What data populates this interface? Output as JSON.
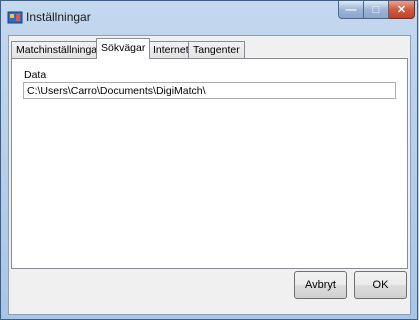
{
  "window": {
    "title": "Inställningar"
  },
  "title_controls": {
    "minimize": "—",
    "maximize": "□",
    "close": "✕"
  },
  "tabs": [
    {
      "label": "Matchinställningar",
      "active": false
    },
    {
      "label": "Sökvägar",
      "active": true
    },
    {
      "label": "Internet",
      "active": false
    },
    {
      "label": "Tangenter",
      "active": false
    }
  ],
  "panel": {
    "data_label": "Data",
    "data_path": "C:\\Users\\Carro\\Documents\\DigiMatch\\"
  },
  "buttons": {
    "cancel": "Avbryt",
    "ok": "OK"
  }
}
